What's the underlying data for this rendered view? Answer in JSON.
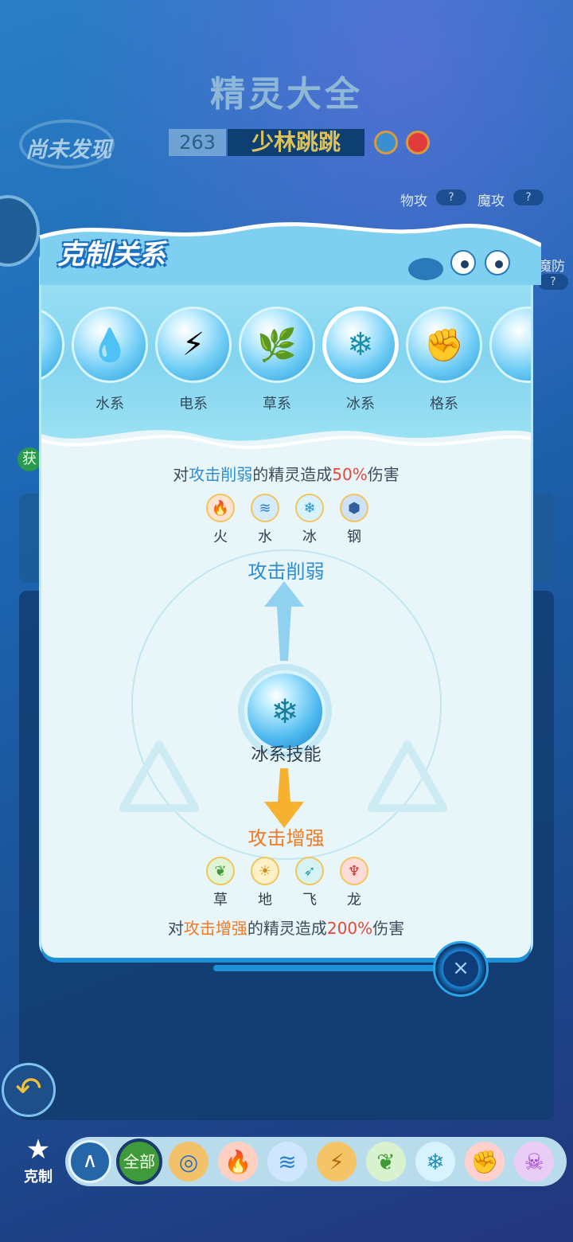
{
  "page": {
    "title": "精灵大全",
    "undiscovered": "尚未发现"
  },
  "pet": {
    "number": "263",
    "name": "少林跳跳"
  },
  "stats": {
    "physical_attack": "物攻",
    "magic_attack": "魔攻",
    "magic_defense": "魔防",
    "unknown": "?"
  },
  "side_tag": "获",
  "modal": {
    "title": "克制关系",
    "types": [
      {
        "label": "水系",
        "icon": "water-drop-icon",
        "glyph": "💧"
      },
      {
        "label": "电系",
        "icon": "lightning-icon",
        "glyph": "⚡"
      },
      {
        "label": "草系",
        "icon": "grass-icon",
        "glyph": "🌿"
      },
      {
        "label": "冰系",
        "icon": "snowflake-icon",
        "glyph": "❄",
        "selected": true
      },
      {
        "label": "格系",
        "icon": "fist-icon",
        "glyph": "✊"
      }
    ],
    "weak_line": {
      "prefix": "对",
      "highlight": "攻击削弱",
      "middle": "的精灵造成",
      "value": "50%",
      "suffix": "伤害"
    },
    "weak_types": [
      "火",
      "水",
      "冰",
      "钢"
    ],
    "weak_label": "攻击削弱",
    "center_label": "冰系技能",
    "strong_label": "攻击增强",
    "strong_types": [
      "草",
      "地",
      "飞",
      "龙"
    ],
    "strong_line": {
      "prefix": "对",
      "highlight": "攻击增强",
      "middle": "的精灵造成",
      "value": "200%",
      "suffix": "伤害"
    },
    "close": "×"
  },
  "bottom": {
    "counter_label": "克制",
    "all_label": "全部",
    "up": "∧"
  },
  "colors": {
    "accent_blue": "#2e8ed3",
    "accent_orange": "#f07a24",
    "accent_red": "#e7473a"
  }
}
